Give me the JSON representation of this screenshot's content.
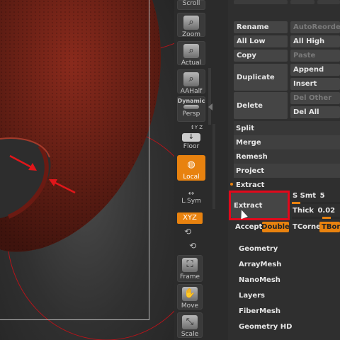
{
  "colors": {
    "accent": "#e8820f",
    "highlight": "#e1081b",
    "mesh": "#8b2a1e",
    "panel": "#2f2f2f"
  },
  "shelf": {
    "scroll": "Scroll",
    "zoom": "Zoom",
    "actual": "Actual",
    "aahalf": "AAHalf",
    "dynamic": "Dynamic",
    "persp": "Persp",
    "floor": "Floor",
    "floor_badge": "↕Y Z",
    "local": "Local",
    "lsym": "L.Sym",
    "xyz": "XYZ",
    "frame": "Frame",
    "move": "Move",
    "scale": "Scale"
  },
  "subtool": {
    "rename": "Rename",
    "autoreorder": "AutoReorder",
    "all_low": "All Low",
    "all_high": "All High",
    "copy": "Copy",
    "paste": "Paste",
    "duplicate": "Duplicate",
    "append": "Append",
    "insert": "Insert",
    "delete": "Delete",
    "del_other": "Del Other",
    "del_all": "Del All",
    "split": "Split",
    "merge": "Merge",
    "remesh": "Remesh",
    "project": "Project",
    "extract_header": "Extract"
  },
  "extract": {
    "button": "Extract",
    "s_smt_label": "S Smt",
    "s_smt_value": "5",
    "thick_label": "Thick",
    "thick_value": "0.02",
    "accept": "Accept",
    "double": "Double",
    "tcorne": "TCorne",
    "tbord": "TBord"
  },
  "menus": [
    "Geometry",
    "ArrayMesh",
    "NanoMesh",
    "Layers",
    "FiberMesh",
    "Geometry HD"
  ]
}
